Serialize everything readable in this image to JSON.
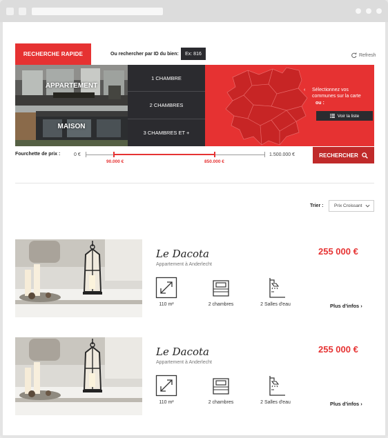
{
  "search": {
    "tab_label": "RECHERCHE RAPIDE",
    "id_label": "Ou rechercher par ID du bien:",
    "id_placeholder": "Ex: 816",
    "refresh_label": "Refresh",
    "types": [
      {
        "label": "APPARTEMENT"
      },
      {
        "label": "MAISON"
      }
    ],
    "rooms": [
      "1 CHAMBRE",
      "2 CHAMBRES",
      "3 CHAMBRES ET +"
    ],
    "map_hint": "Sélectionnez vos communes sur la carte",
    "map_or": "ou :",
    "list_button": "Voir la liste",
    "price_label": "Fourchette de prix :",
    "price_min": "0 €",
    "price_max": "1.500.000 €",
    "price_low": "90.000 €",
    "price_high": "850.000 €",
    "search_button": "RECHERCHER"
  },
  "sort": {
    "label": "Trier :",
    "selected": "Prix Croissant"
  },
  "listings": [
    {
      "name": "Le Dacota",
      "subtitle": "Appartement à Anderlecht",
      "price": "255 000 €",
      "area": "110 m²",
      "bedrooms": "2 chambres",
      "bathrooms": "2 Salles d'eau",
      "more": "Plus d'infos"
    },
    {
      "name": "Le Dacota",
      "subtitle": "Appartement à Anderlecht",
      "price": "255 000 €",
      "area": "110 m²",
      "bedrooms": "2 chambres",
      "bathrooms": "2 Salles d'eau",
      "more": "Plus d'infos"
    }
  ],
  "colors": {
    "accent": "#e63232",
    "dark": "#2b2b2f"
  },
  "icons": [
    "refresh-icon",
    "chevron-left-icon",
    "list-icon",
    "search-icon",
    "chevron-down-icon",
    "area-icon",
    "bed-icon",
    "shower-icon",
    "chevron-right-icon"
  ]
}
